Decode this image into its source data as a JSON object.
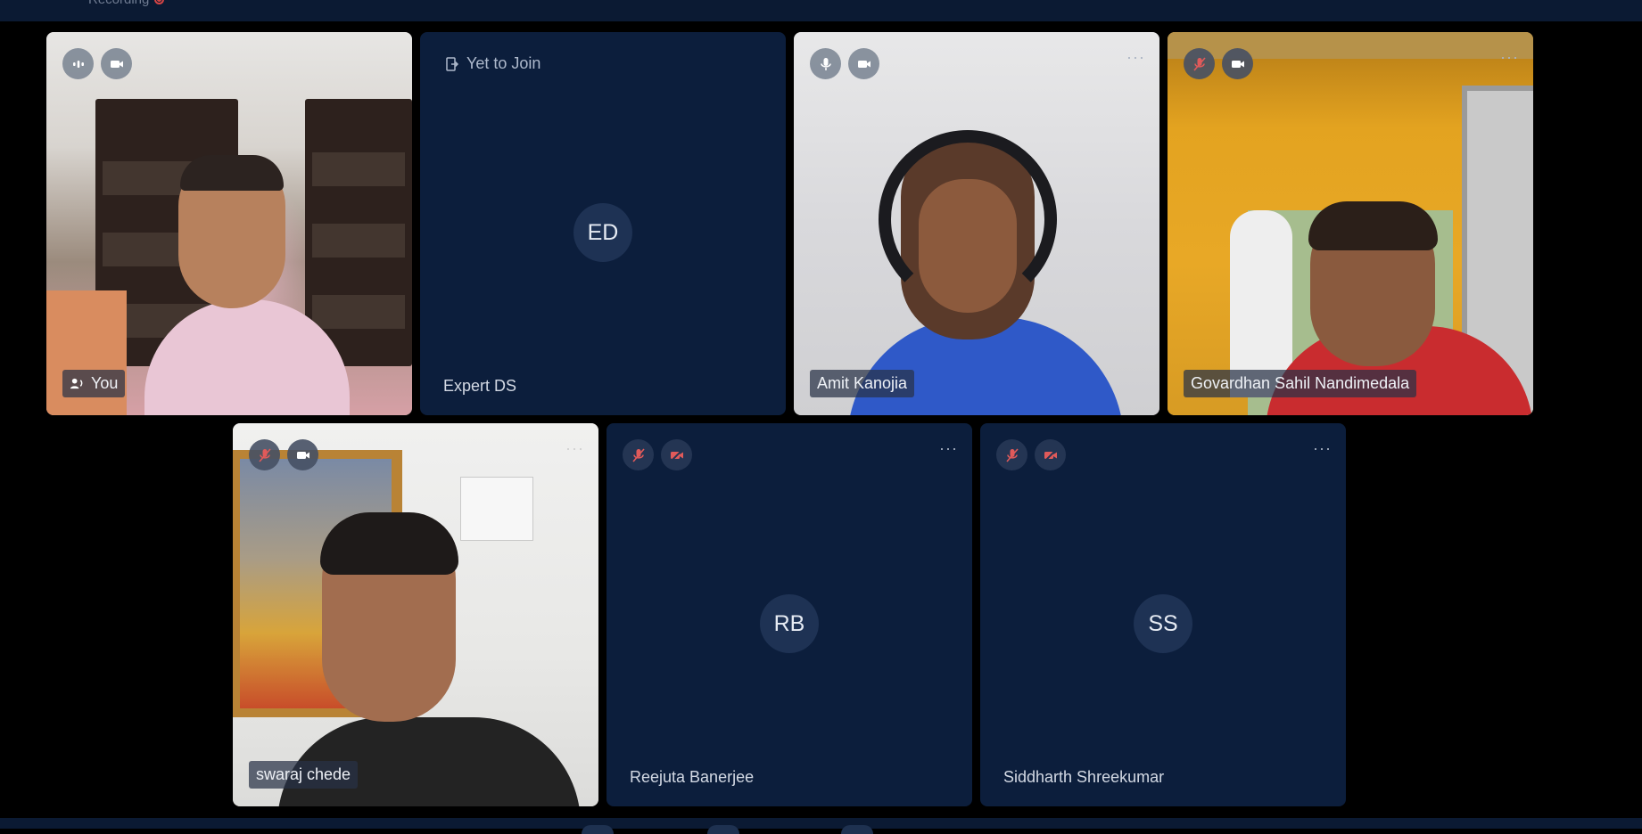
{
  "header": {
    "recording_label": "Recording"
  },
  "participants": [
    {
      "name": "You",
      "initials": "",
      "status": "",
      "mic": "on",
      "camera": "on",
      "video": true,
      "speaking": true
    },
    {
      "name": "Expert DS",
      "initials": "ED",
      "status": "Yet to Join",
      "mic": "none",
      "camera": "none",
      "video": false
    },
    {
      "name": "Amit Kanojia",
      "initials": "",
      "status": "",
      "mic": "on",
      "camera": "on",
      "video": true
    },
    {
      "name": "Govardhan Sahil Nandimedala",
      "initials": "",
      "status": "",
      "mic": "muted",
      "camera": "on",
      "video": true
    },
    {
      "name": "swaraj chede",
      "initials": "",
      "status": "",
      "mic": "muted",
      "camera": "on",
      "video": true
    },
    {
      "name": "Reejuta Banerjee",
      "initials": "RB",
      "status": "",
      "mic": "muted",
      "camera": "off",
      "video": false
    },
    {
      "name": "Siddharth Shreekumar",
      "initials": "SS",
      "status": "",
      "mic": "muted",
      "camera": "off",
      "video": false
    }
  ],
  "colors": {
    "background": "#000000",
    "tile": "#0c1e3c",
    "bar": "#0b1a33",
    "muted_icon": "#e05a5a",
    "recording": "#d64545"
  },
  "icons": {
    "more": "more-horizontal-icon",
    "mic": "microphone-icon",
    "mic_muted": "microphone-muted-icon",
    "camera": "camera-icon",
    "camera_off": "camera-off-icon",
    "yet_to_join": "door-exit-icon",
    "speaking": "speaker-wave-icon"
  }
}
